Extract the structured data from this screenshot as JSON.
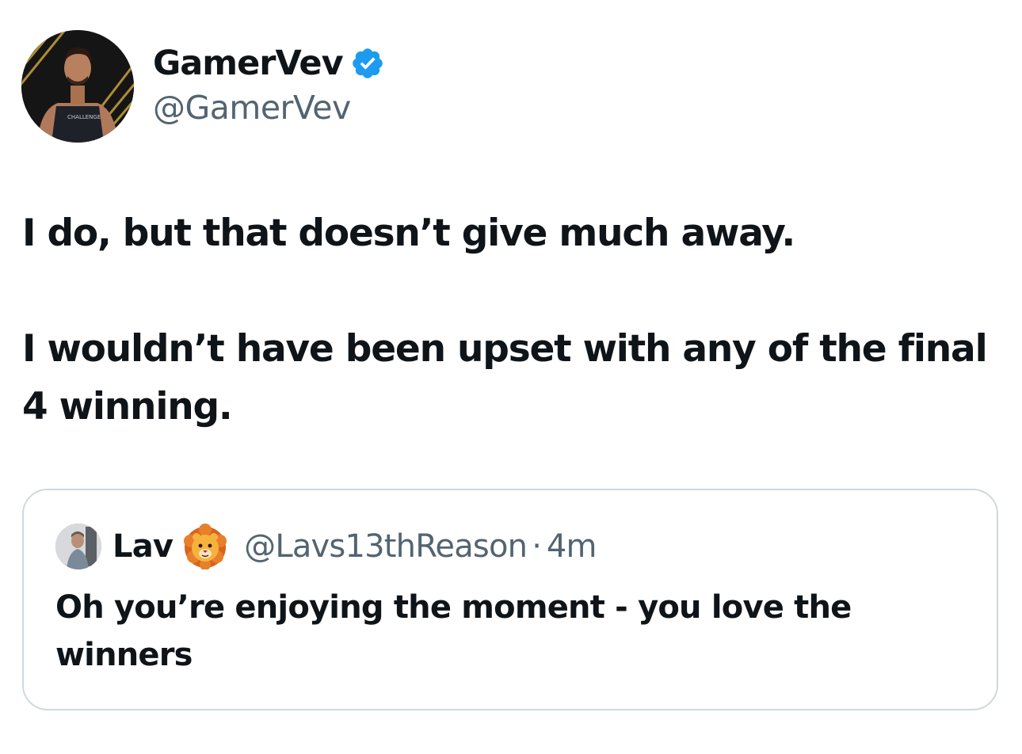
{
  "author": {
    "display_name": "GamerVev",
    "handle": "@GamerVev",
    "verified": true,
    "verified_icon": "verified-badge-icon",
    "verified_color": "#1d9bf0"
  },
  "tweet": {
    "paragraphs": [
      "I do, but that doesn’t give much away.",
      "I wouldn’t have been upset with any of the final 4 winning."
    ]
  },
  "quoted_tweet": {
    "display_name": "Lav",
    "emoji": "lion-face-emoji",
    "handle": "@Lavs13thReason",
    "separator": "·",
    "time": "4m",
    "text": "Oh you’re enjoying the moment - you love the winners"
  },
  "colors": {
    "text_primary": "#0f1419",
    "text_secondary": "#536471",
    "border": "#cfd9de"
  }
}
